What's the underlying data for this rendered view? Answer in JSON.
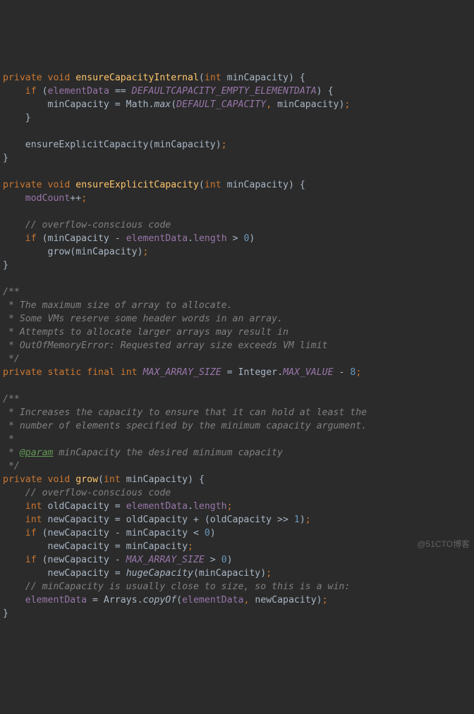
{
  "code": {
    "l01": {
      "kw1": "private",
      "kw2": "void",
      "name": "ensureCapacityInternal",
      "lp": "(",
      "kw3": "int",
      "arg": "minCapacity",
      "rp": ")",
      "ob": " {"
    },
    "l02": {
      "ind": "    ",
      "kw": "if",
      "lp": " (",
      "fld": "elementData",
      "eq": " == ",
      "cst": "DEFAULTCAPACITY_EMPTY_ELEMENTDATA",
      "rp": ")",
      "ob": " {"
    },
    "l03": {
      "ind": "        ",
      "v": "minCapacity = Math.",
      "m": "max",
      "lp": "(",
      "cst": "DEFAULT_CAPACITY",
      "c": ",",
      "a2": " minCapacity)",
      "semi": ";"
    },
    "l04": {
      "ind": "    ",
      "cb": "}"
    },
    "l06": {
      "ind": "    ",
      "call": "ensureExplicitCapacity(minCapacity)",
      "semi": ";"
    },
    "l07": {
      "cb": "}"
    },
    "l09": {
      "kw1": "private",
      "kw2": "void",
      "name": "ensureExplicitCapacity",
      "lp": "(",
      "kw3": "int",
      "arg": "minCapacity",
      "rp": ")",
      "ob": " {"
    },
    "l10": {
      "ind": "    ",
      "fld": "modCount",
      "op": "++",
      "semi": ";"
    },
    "l12": {
      "ind": "    ",
      "cm": "// overflow-conscious code"
    },
    "l13": {
      "ind": "    ",
      "kw": "if",
      "a": " (minCapacity - ",
      "fld": "elementData",
      "dot": ".",
      "len": "length",
      "op": " > ",
      "num": "0",
      "rp": ")"
    },
    "l14": {
      "ind": "        ",
      "call": "grow(minCapacity)",
      "semi": ";"
    },
    "l15": {
      "cb": "}"
    },
    "l17": {
      "cm": "/**"
    },
    "l18": {
      "cm": " * The maximum size of array to allocate."
    },
    "l19": {
      "cm": " * Some VMs reserve some header words in an array."
    },
    "l20": {
      "cm": " * Attempts to allocate larger arrays may result in"
    },
    "l21": {
      "cm": " * OutOfMemoryError: Requested array size exceeds VM limit"
    },
    "l22": {
      "cm": " */"
    },
    "l23": {
      "kw1": "private",
      "kw2": "static",
      "kw3": "final",
      "kw4": "int",
      "cst": "MAX_ARRAY_SIZE",
      "eq": " = Integer.",
      "cst2": "MAX_VALUE",
      "op": " - ",
      "num": "8",
      "semi": ";"
    },
    "l25": {
      "cm": "/**"
    },
    "l26": {
      "cm": " * Increases the capacity to ensure that it can hold at least the"
    },
    "l27": {
      "cm": " * number of elements specified by the minimum capacity argument."
    },
    "l28": {
      "cm": " *"
    },
    "l29": {
      "pre": " * ",
      "tag": "@param",
      "rest": " minCapacity the desired minimum capacity"
    },
    "l30": {
      "cm": " */"
    },
    "l31": {
      "kw1": "private",
      "kw2": "void",
      "name": "grow",
      "lp": "(",
      "kw3": "int",
      "arg": "minCapacity",
      "rp": ")",
      "ob": " {"
    },
    "l32": {
      "ind": "    ",
      "cm": "// overflow-conscious code"
    },
    "l33": {
      "ind": "    ",
      "kw": "int",
      "v": " oldCapacity = ",
      "fld": "elementData",
      "dot": ".",
      "len": "length",
      "semi": ";"
    },
    "l34": {
      "ind": "    ",
      "kw": "int",
      "v": " newCapacity = oldCapacity + (oldCapacity >> ",
      "num": "1",
      "rp": ")",
      "semi": ";"
    },
    "l35": {
      "ind": "    ",
      "kw": "if",
      "v": " (newCapacity - minCapacity < ",
      "num": "0",
      "rp": ")"
    },
    "l36": {
      "ind": "        ",
      "v": "newCapacity = minCapacity",
      "semi": ";"
    },
    "l37": {
      "ind": "    ",
      "kw": "if",
      "v": " (newCapacity - ",
      "cst": "MAX_ARRAY_SIZE",
      "op": " > ",
      "num": "0",
      "rp": ")"
    },
    "l38": {
      "ind": "        ",
      "v": "newCapacity = ",
      "m": "hugeCapacity",
      "a": "(minCapacity)",
      "semi": ";"
    },
    "l39": {
      "ind": "    ",
      "cm": "// minCapacity is usually close to size, so this is a win:"
    },
    "l40": {
      "ind": "    ",
      "fld": "elementData",
      "eq": " = Arrays.",
      "m": "copyOf",
      "lp": "(",
      "fld2": "elementData",
      "c": ",",
      "a2": " newCapacity)",
      "semi": ";"
    },
    "l41": {
      "cb": "}"
    }
  },
  "watermark": "@51CTO博客"
}
